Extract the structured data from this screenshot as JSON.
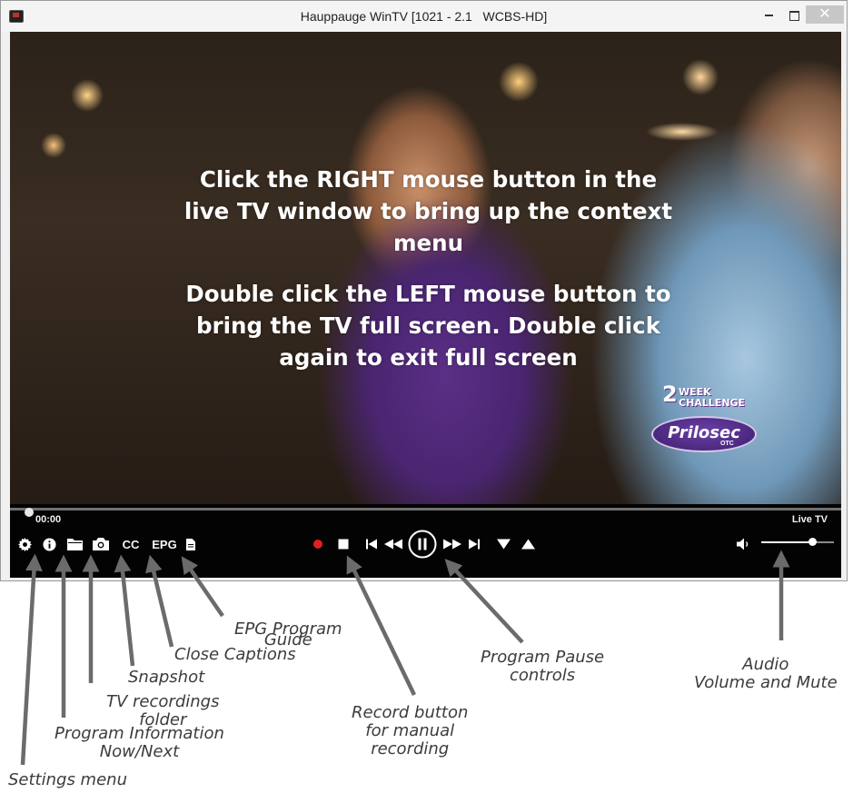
{
  "window": {
    "title": "Hauppauge WinTV [1021 - 2.1   WCBS-HD]",
    "close_glyph": "✕"
  },
  "video": {
    "overlay_text_1": [
      "Click the RIGHT mouse button in the",
      "live TV window to bring up the context",
      "menu"
    ],
    "overlay_text_2": [
      "Double click the LEFT mouse button to",
      "bring the TV full screen. Double click",
      "again to exit full screen"
    ],
    "ad": {
      "number": "2",
      "line1": "WEEK",
      "line2": "CHALLENGE",
      "brand": "Prilosec",
      "sub": "OTC"
    }
  },
  "controls": {
    "elapsed": "00:00",
    "mode": "Live TV",
    "seek_position": 0.012,
    "volume_level": 0.7,
    "cc_label": "CC",
    "epg_label": "EPG",
    "icons": [
      "gear-icon",
      "info-icon",
      "folder-icon",
      "camera-icon",
      "document-icon",
      "record-dot-icon",
      "stop-icon",
      "skip-back-icon",
      "rewind-icon",
      "pause-icon",
      "fast-forward-icon",
      "skip-forward-icon",
      "channel-down-icon",
      "channel-up-icon",
      "speaker-icon"
    ],
    "record_color": "#e02020"
  },
  "annotations": {
    "epg_guide": [
      "EPG Program",
      "Guide"
    ],
    "close_captions": [
      "Close Captions"
    ],
    "snapshot": [
      "Snapshot"
    ],
    "recordings_folder": [
      "TV recordings",
      "folder"
    ],
    "program_info": [
      "Program Information",
      "Now/Next"
    ],
    "settings": [
      "Settings menu"
    ],
    "record": [
      "Record button",
      "for manual",
      "recording"
    ],
    "pause_controls": [
      "Program Pause",
      "controls"
    ],
    "audio": [
      "Audio",
      "Volume and Mute"
    ],
    "arrow_color": "#6b6b6b"
  }
}
